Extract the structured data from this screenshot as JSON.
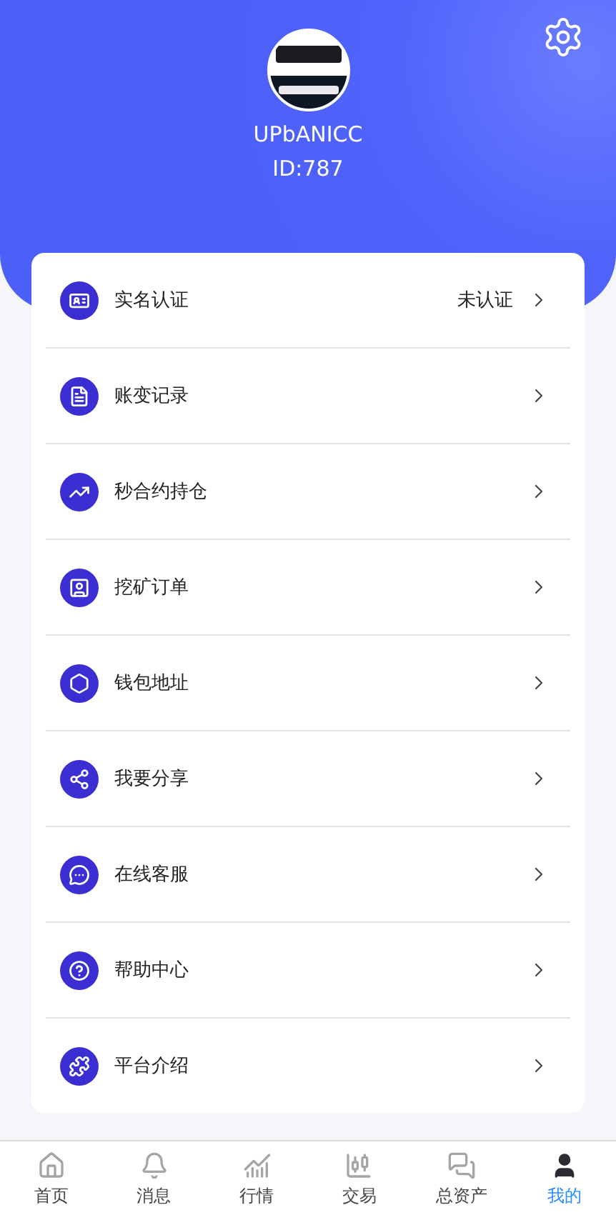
{
  "profile": {
    "username": "UPbANICC",
    "user_id": "ID:787"
  },
  "menu": [
    {
      "label": "实名认证",
      "status": "未认证"
    },
    {
      "label": "账变记录"
    },
    {
      "label": "秒合约持仓"
    },
    {
      "label": "挖矿订单"
    },
    {
      "label": "钱包地址"
    },
    {
      "label": "我要分享"
    },
    {
      "label": "在线客服"
    },
    {
      "label": "帮助中心"
    },
    {
      "label": "平台介绍"
    }
  ],
  "tab_bar": [
    {
      "label": "首页",
      "selected": false
    },
    {
      "label": "消息",
      "selected": false
    },
    {
      "label": "行情",
      "selected": false
    },
    {
      "label": "交易",
      "selected": false
    },
    {
      "label": "总资产",
      "selected": false
    },
    {
      "label": "我的",
      "selected": true
    }
  ]
}
